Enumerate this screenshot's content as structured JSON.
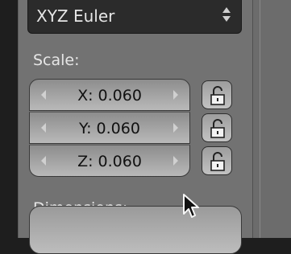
{
  "rotation_mode": {
    "value": "XYZ Euler"
  },
  "scale": {
    "label": "Scale:",
    "x": "X: 0.060",
    "y": "Y: 0.060",
    "z": "Z: 0.060"
  },
  "dimensions": {
    "label": "Dimensions:"
  },
  "icons": {
    "lock": "unlocked-padlock-icon",
    "updown": "up-down-chevron-icon",
    "decrement": "left-arrow-icon",
    "increment": "right-arrow-icon",
    "cursor": "mouse-pointer-icon"
  },
  "colors": {
    "panel": "#727272",
    "field": "#b0b0b0",
    "dropdown": "#2b2b2b",
    "text_light": "#e6e6e6",
    "text_dark": "#111111"
  }
}
